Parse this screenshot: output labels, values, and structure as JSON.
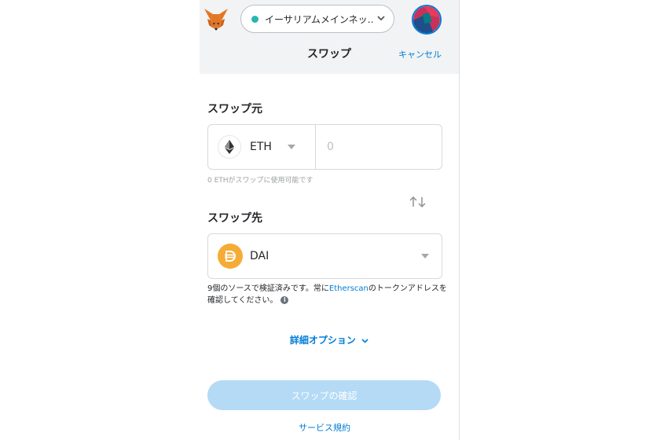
{
  "header": {
    "network_label": "イーサリアムメインネッ…",
    "title": "スワップ",
    "cancel_label": "キャンセル"
  },
  "from": {
    "section_label": "スワップ元",
    "token_symbol": "ETH",
    "amount_placeholder": "0",
    "balance_hint": "0 ETHがスワップに使用可能です"
  },
  "to": {
    "section_label": "スワップ先",
    "token_symbol": "DAI",
    "verify_text_before": "9個のソースで検証済みです。常に",
    "verify_link": "Etherscan",
    "verify_text_after": "のトークンアドレスを確認してください。"
  },
  "advanced_options_label": "詳細オプション",
  "confirm_button_label": "スワップの確認",
  "terms_link": "サービス規約",
  "colors": {
    "accent": "#037dd6",
    "network_dot": "#29b6af",
    "dai": "#f5ac37",
    "confirm_disabled": "#b4daf5"
  },
  "icons": [
    "metamask-fox-icon",
    "chevron-down-icon",
    "ethereum-icon",
    "swap-arrows-icon",
    "dai-icon",
    "info-icon"
  ]
}
